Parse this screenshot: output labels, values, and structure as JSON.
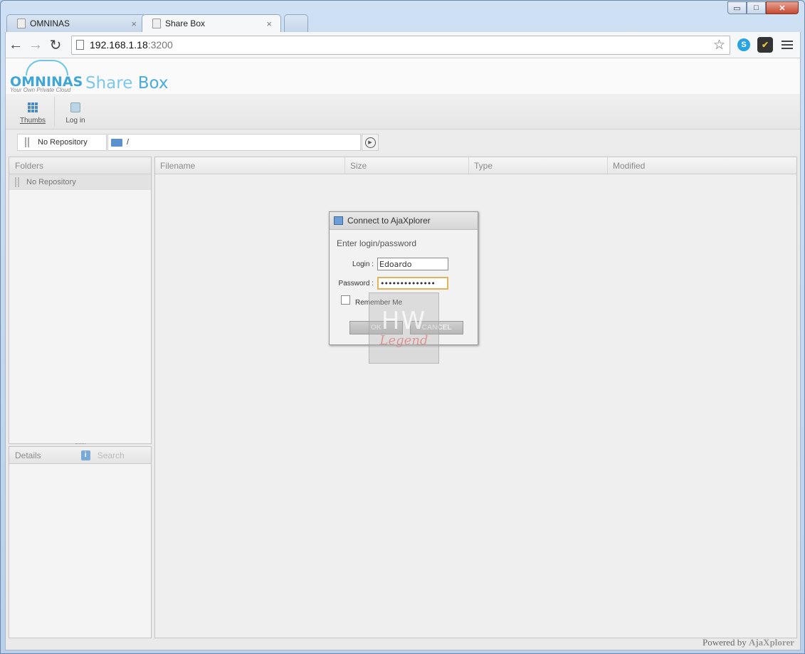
{
  "browser": {
    "tabs": [
      {
        "title": "OMNINAS",
        "close": "×"
      },
      {
        "title": "Share Box",
        "close": "×"
      }
    ],
    "window_controls": {
      "minimize": "▭",
      "maximize": "□",
      "close": "✕"
    },
    "nav": {
      "back": "←",
      "forward": "→",
      "reload": "↻"
    },
    "address": {
      "host": "192.168.1.18",
      "port": ":3200"
    },
    "bookmark_icon": "☆",
    "extensions": {
      "skype": "S",
      "check": "✔"
    }
  },
  "app": {
    "logo": {
      "brand": "OMNINAS",
      "tagline": "Your Own Private Cloud"
    },
    "title": {
      "part1": "Share ",
      "part2": "Box"
    },
    "actions": [
      {
        "label": "Thumbs",
        "icon": "grid-icon"
      },
      {
        "label": "Log in",
        "icon": "login-icon"
      }
    ],
    "location": {
      "repository": "No Repository",
      "path": "/"
    },
    "folders_panel": {
      "title": "Folders",
      "items": [
        "No Repository"
      ]
    },
    "details_panel": {
      "title": "Details",
      "info_icon": "i",
      "search_tab": "Search"
    },
    "file_list": {
      "columns": [
        "Filename",
        "Size",
        "Type",
        "Modified"
      ]
    },
    "footer": {
      "prefix": "Powered by ",
      "brand": "AjaXplorer"
    }
  },
  "dialog": {
    "title": "Connect to AjaXplorer",
    "legend": "Enter login/password",
    "login_label": "Login :",
    "login_value": "Edoardo",
    "password_label": "Password :",
    "password_value": "••••••••••••••",
    "remember_label": "Remember Me",
    "ok_label": "OK",
    "cancel_label": "CANCEL"
  },
  "watermark": {
    "top": "HW",
    "bottom": "Legend"
  },
  "colors": {
    "accent": "#3fa6d6",
    "title_light": "#7cc8ec",
    "focus_border": "#e0b45a"
  }
}
